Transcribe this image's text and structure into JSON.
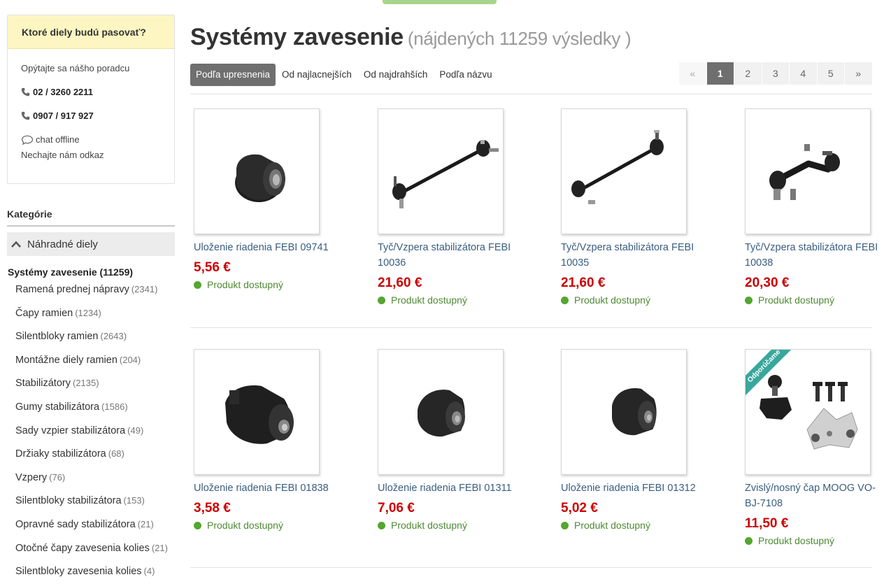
{
  "help": {
    "title": "Ktoré diely budú pasovať?",
    "intro": "Opýtajte sa nášho poradcu",
    "phone1": "02 / 3260 2211",
    "phone2": "0907 / 917 927",
    "chat_status": "chat offline",
    "leave_message": "Nechajte nám odkaz"
  },
  "categories": {
    "title": "Kategórie",
    "parent": "Náhradné diely",
    "current": "Systémy zavesenie (11259)",
    "items": [
      {
        "label": "Ramená prednej nápravy",
        "count": "(2341)"
      },
      {
        "label": "Čapy ramien",
        "count": "(1234)"
      },
      {
        "label": "Silentbloky ramien",
        "count": "(2643)"
      },
      {
        "label": "Montážne diely ramien",
        "count": "(204)"
      },
      {
        "label": "Stabilizátory",
        "count": "(2135)"
      },
      {
        "label": "Gumy stabilizátora",
        "count": "(1586)"
      },
      {
        "label": "Sady vzpier stabilizátora",
        "count": "(49)"
      },
      {
        "label": "Držiaky stabilizátora",
        "count": "(68)"
      },
      {
        "label": "Vzpery",
        "count": "(76)"
      },
      {
        "label": "Silentbloky stabilizátora",
        "count": "(153)"
      },
      {
        "label": "Opravné sady stabilizátora",
        "count": "(21)"
      },
      {
        "label": "Otočné čapy zavesenia kolies",
        "count": "(21)"
      },
      {
        "label": "Silentbloky zavesenia kolies",
        "count": "(4)"
      }
    ]
  },
  "main": {
    "title": "Systémy zavesenie",
    "subtitle": "(nájdených 11259 výsledky )"
  },
  "sort": {
    "options": [
      "Podľa upresnenia",
      "Od najlacnejších",
      "Od najdrahších",
      "Podľa názvu"
    ],
    "active": "Podľa upresnenia"
  },
  "pagination": {
    "prev": "«",
    "pages": [
      "1",
      "2",
      "3",
      "4",
      "5"
    ],
    "current": "1",
    "next": "»"
  },
  "products": [
    {
      "name": "Uloženie riadenia FEBI 09741",
      "price": "5,56 €",
      "availability": "Produkt dostupný",
      "image": "bushing-image"
    },
    {
      "name": "Tyč/Vzpera stabilizátora FEBI 10036",
      "price": "21,60 €",
      "availability": "Produkt dostupný",
      "image": "stabilizer-link-image"
    },
    {
      "name": "Tyč/Vzpera stabilizátora FEBI 10035",
      "price": "21,60 €",
      "availability": "Produkt dostupný",
      "image": "stabilizer-link-image"
    },
    {
      "name": "Tyč/Vzpera stabilizátora FEBI 10038",
      "price": "20,30 €",
      "availability": "Produkt dostupný",
      "image": "stabilizer-link-image"
    },
    {
      "name": "Uloženie riadenia FEBI 01838",
      "price": "3,58 €",
      "availability": "Produkt dostupný",
      "image": "bushing-image"
    },
    {
      "name": "Uloženie riadenia FEBI 01311",
      "price": "7,06 €",
      "availability": "Produkt dostupný",
      "image": "bushing-image"
    },
    {
      "name": "Uloženie riadenia FEBI 01312",
      "price": "5,02 €",
      "availability": "Produkt dostupný",
      "image": "bushing-image"
    },
    {
      "name": "Zvislý/nosný čap MOOG VO-BJ-7108",
      "price": "11,50 €",
      "availability": "Produkt dostupný",
      "image": "ball-joint-image",
      "badge": "Odporúčame"
    }
  ],
  "colors": {
    "price": "#cc0000",
    "link": "#3a5d7f",
    "available": "#55a630",
    "badge": "#3aa79c",
    "help_header": "#fdf6c3"
  }
}
